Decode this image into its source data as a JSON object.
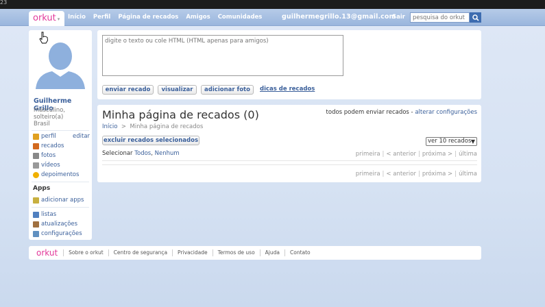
{
  "top_strip": {
    "text": "23"
  },
  "nav": {
    "logo": "orkut",
    "logo_arrow": "▾",
    "links": [
      "Início",
      "Perfil",
      "Página de recados",
      "Amigos",
      "Comunidades"
    ],
    "email": "guilhermegrillo.13@gmail.com",
    "logout": "Sair",
    "search_placeholder": "pesquisa do orkut"
  },
  "profile": {
    "name": "Guilherme Grillo",
    "info": [
      "masculino,",
      "solteiro(a)",
      "Brasil"
    ],
    "edit": "editar",
    "menu": [
      {
        "label": "perfil",
        "icon": "person-icon",
        "color": "#e0a020"
      },
      {
        "label": "recados",
        "icon": "pencil-note-icon",
        "color": "#d2691e"
      },
      {
        "label": "fotos",
        "icon": "photo-icon",
        "color": "#888888"
      },
      {
        "label": "vídeos",
        "icon": "video-icon",
        "color": "#999999"
      },
      {
        "label": "depoimentos",
        "icon": "sun-icon",
        "color": "#f0b000"
      }
    ],
    "apps_heading": "Apps",
    "apps": [
      {
        "label": "adicionar apps",
        "icon": "plus-icon",
        "color": "#c8b040"
      }
    ],
    "extra": [
      {
        "label": "listas",
        "icon": "list-icon",
        "color": "#5080c0"
      },
      {
        "label": "atualizações",
        "icon": "updates-icon",
        "color": "#a07040"
      },
      {
        "label": "configurações",
        "icon": "wrench-icon",
        "color": "#6090c0"
      }
    ]
  },
  "compose": {
    "placeholder": "digite o texto ou cole HTML (HTML apenas para amigos)",
    "send": "enviar recado",
    "preview": "visualizar",
    "add_photo": "adicionar foto",
    "tips": "dicas de recados"
  },
  "scrapbook": {
    "title": "Minha página de recados (0)",
    "permission_text": "todos podem enviar recados -",
    "permission_link": "alterar configurações",
    "crumb_home": "Início",
    "crumb_sep": ">",
    "crumb_current": "Minha página de recados",
    "delete_selected": "excluir recados selecionados",
    "per_page": "ver 10 recados",
    "select_label": "Selecionar",
    "select_all": "Todos",
    "select_comma": ",",
    "select_none": "Nenhum",
    "pager": {
      "first": "primeira",
      "prev": "< anterior",
      "next": "próxima >",
      "last": "última",
      "sep": "|"
    }
  },
  "footer": {
    "logo": "orkut",
    "links": [
      "Sobre o orkut",
      "Centro de segurança",
      "Privacidade",
      "Termos de uso",
      "Ajuda",
      "Contato"
    ]
  }
}
